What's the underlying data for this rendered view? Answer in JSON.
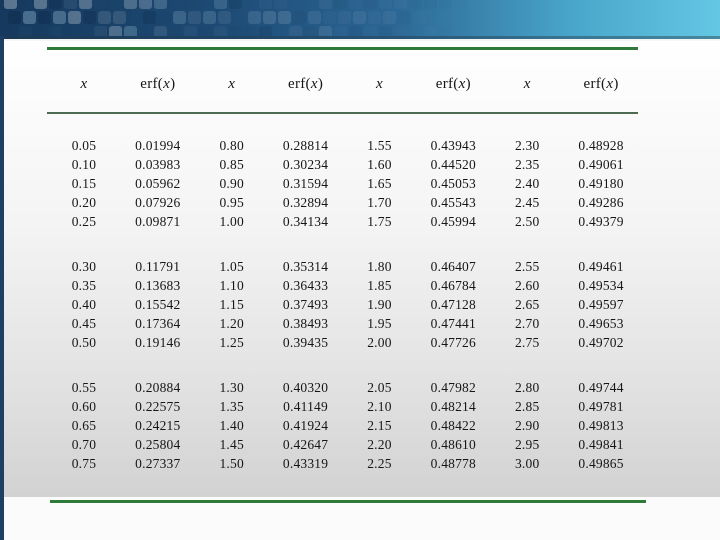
{
  "theme": {
    "banner_dark": "#16395e",
    "banner_mid": "#2c6795",
    "banner_light": "#64c7e3",
    "rule_green": "#2f7a38",
    "left_bar": "#1c3f63",
    "text_color": "#161616"
  },
  "table": {
    "header": [
      "x",
      "erf(x)",
      "x",
      "erf(x)",
      "x",
      "erf(x)",
      "x",
      "erf(x)"
    ],
    "groups": [
      {
        "rows": [
          [
            "0.05",
            "0.01994",
            "0.80",
            "0.28814",
            "1.55",
            "0.43943",
            "2.30",
            "0.48928"
          ],
          [
            "0.10",
            "0.03983",
            "0.85",
            "0.30234",
            "1.60",
            "0.44520",
            "2.35",
            "0.49061"
          ],
          [
            "0.15",
            "0.05962",
            "0.90",
            "0.31594",
            "1.65",
            "0.45053",
            "2.40",
            "0.49180"
          ],
          [
            "0.20",
            "0.07926",
            "0.95",
            "0.32894",
            "1.70",
            "0.45543",
            "2.45",
            "0.49286"
          ],
          [
            "0.25",
            "0.09871",
            "1.00",
            "0.34134",
            "1.75",
            "0.45994",
            "2.50",
            "0.49379"
          ]
        ]
      },
      {
        "rows": [
          [
            "0.30",
            "0.11791",
            "1.05",
            "0.35314",
            "1.80",
            "0.46407",
            "2.55",
            "0.49461"
          ],
          [
            "0.35",
            "0.13683",
            "1.10",
            "0.36433",
            "1.85",
            "0.46784",
            "2.60",
            "0.49534"
          ],
          [
            "0.40",
            "0.15542",
            "1.15",
            "0.37493",
            "1.90",
            "0.47128",
            "2.65",
            "0.49597"
          ],
          [
            "0.45",
            "0.17364",
            "1.20",
            "0.38493",
            "1.95",
            "0.47441",
            "2.70",
            "0.49653"
          ],
          [
            "0.50",
            "0.19146",
            "1.25",
            "0.39435",
            "2.00",
            "0.47726",
            "2.75",
            "0.49702"
          ]
        ]
      },
      {
        "rows": [
          [
            "0.55",
            "0.20884",
            "1.30",
            "0.40320",
            "2.05",
            "0.47982",
            "2.80",
            "0.49744"
          ],
          [
            "0.60",
            "0.22575",
            "1.35",
            "0.41149",
            "2.10",
            "0.48214",
            "2.85",
            "0.49781"
          ],
          [
            "0.65",
            "0.24215",
            "1.40",
            "0.41924",
            "2.15",
            "0.48422",
            "2.90",
            "0.49813"
          ],
          [
            "0.70",
            "0.25804",
            "1.45",
            "0.42647",
            "2.20",
            "0.48610",
            "2.95",
            "0.49841"
          ],
          [
            "0.75",
            "0.27337",
            "1.50",
            "0.43319",
            "2.25",
            "0.48778",
            "3.00",
            "0.49865"
          ]
        ]
      }
    ]
  }
}
